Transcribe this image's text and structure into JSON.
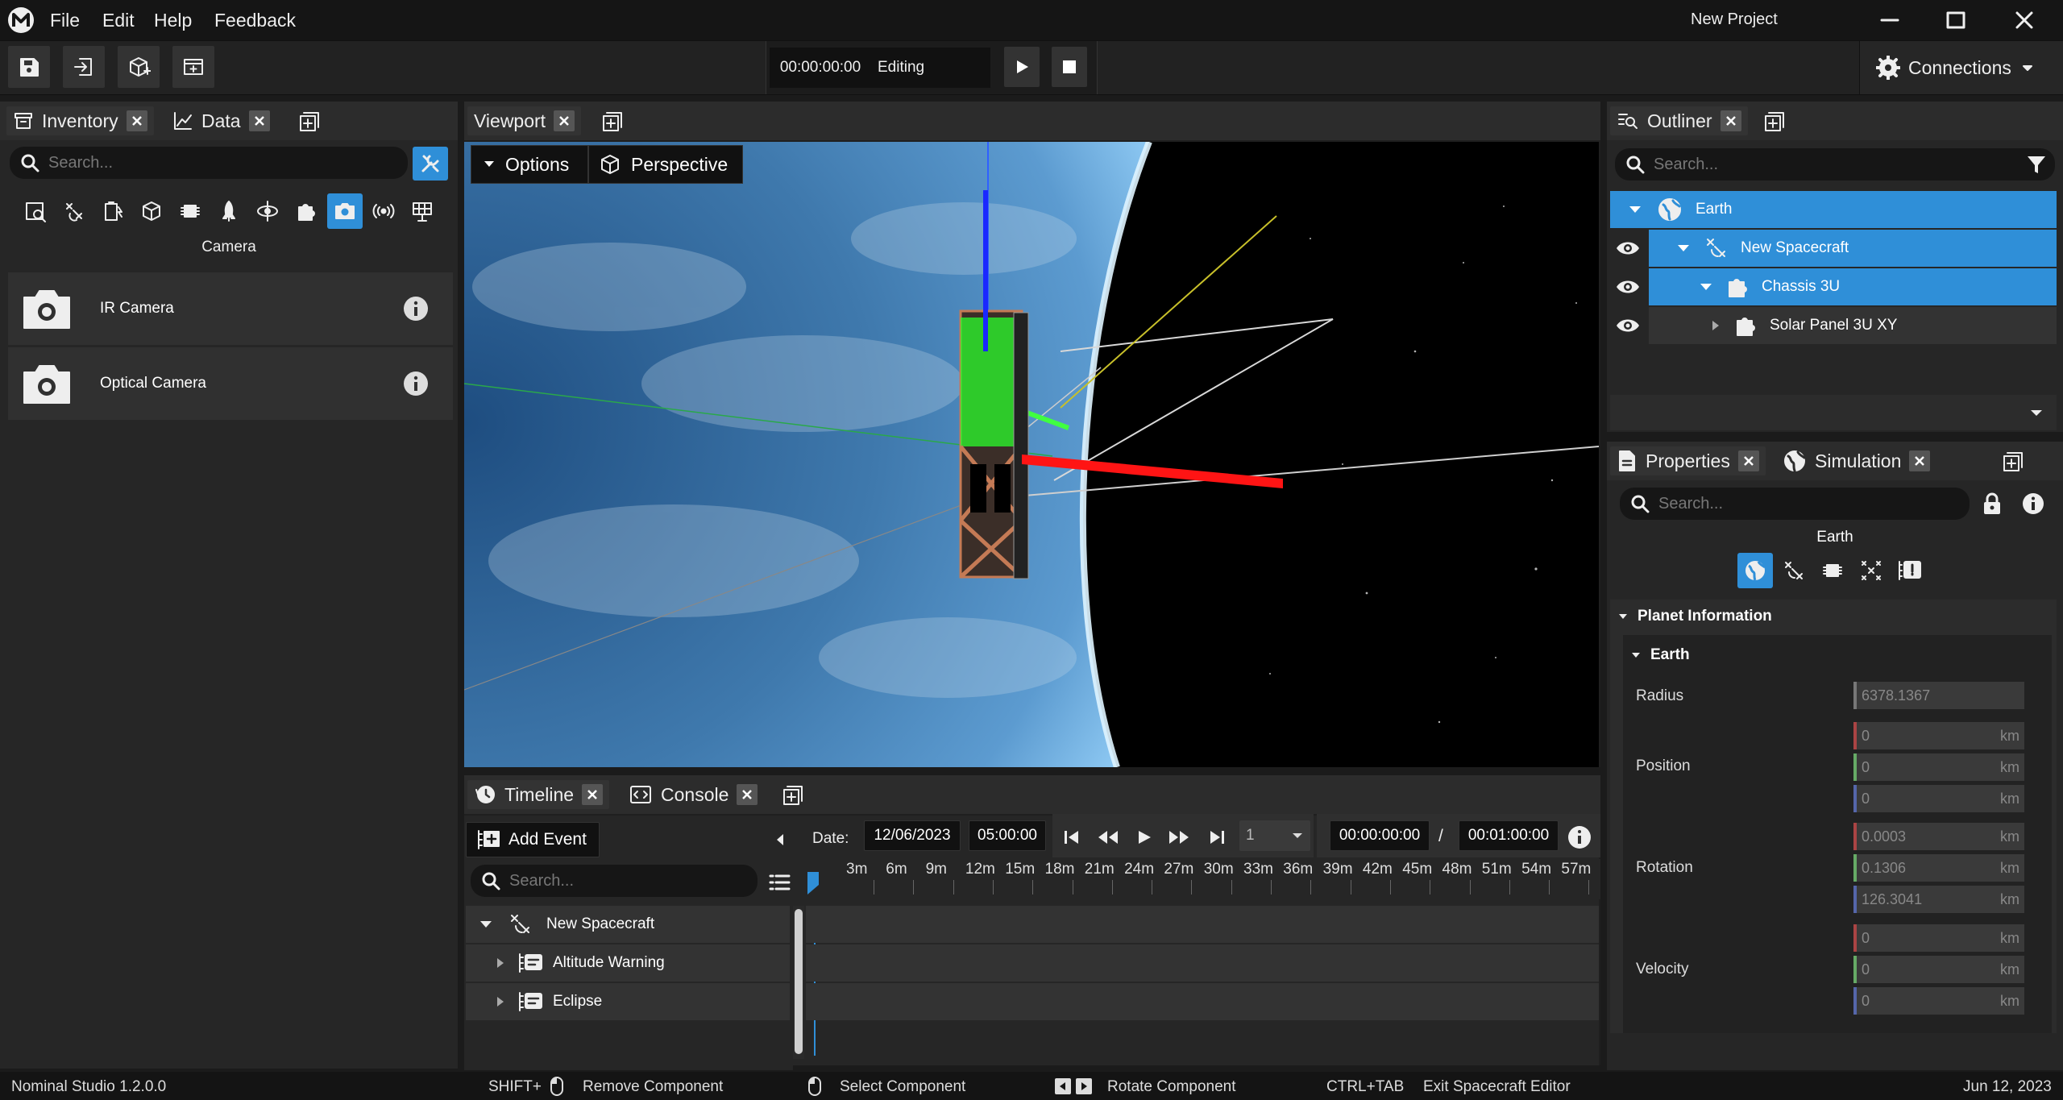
{
  "app": {
    "title": "New Project"
  },
  "menu": [
    "File",
    "Edit",
    "Help",
    "Feedback"
  ],
  "toolbar": {
    "time": "00:00:00:00",
    "mode": "Editing",
    "connections_label": "Connections"
  },
  "inventory": {
    "tabs": [
      {
        "label": "Inventory"
      },
      {
        "label": "Data"
      }
    ],
    "search_placeholder": "Search...",
    "category_label": "Camera",
    "categories": [
      "inventory-search",
      "satellite",
      "battery",
      "cube",
      "chip",
      "rocket",
      "orbit",
      "puzzle",
      "camera",
      "antenna",
      "solar-panel"
    ],
    "active_category": "camera",
    "items": [
      {
        "label": "IR Camera"
      },
      {
        "label": "Optical Camera"
      }
    ]
  },
  "viewport": {
    "tab_label": "Viewport",
    "options_label": "Options",
    "perspective_label": "Perspective"
  },
  "timeline": {
    "tabs": [
      {
        "label": "Timeline"
      },
      {
        "label": "Console"
      }
    ],
    "add_event_label": "Add Event",
    "search_placeholder": "Search...",
    "date_label": "Date:",
    "date": "12/06/2023",
    "time": "05:00:00",
    "speed": "1",
    "current_time": "00:00:00:00",
    "separator": "/",
    "end_time": "00:01:00:00",
    "ticks": [
      "3m",
      "6m",
      "9m",
      "12m",
      "15m",
      "18m",
      "21m",
      "24m",
      "27m",
      "30m",
      "33m",
      "36m",
      "39m",
      "42m",
      "45m",
      "48m",
      "51m",
      "54m",
      "57m"
    ],
    "rows": [
      {
        "label": "New Spacecraft"
      },
      {
        "label": "Altitude Warning"
      },
      {
        "label": "Eclipse"
      }
    ]
  },
  "outliner": {
    "tab_label": "Outliner",
    "search_placeholder": "Search...",
    "tree": [
      {
        "label": "Earth"
      },
      {
        "label": "New Spacecraft"
      },
      {
        "label": "Chassis 3U"
      },
      {
        "label": "Solar Panel 3U XY"
      }
    ]
  },
  "properties": {
    "tabs": [
      {
        "label": "Properties"
      },
      {
        "label": "Simulation"
      }
    ],
    "search_placeholder": "Search...",
    "object_name": "Earth",
    "section": "Planet Information",
    "subsection": "Earth",
    "radius": {
      "label": "Radius",
      "value": "6378.1367"
    },
    "position": {
      "label": "Position",
      "values": [
        "0",
        "0",
        "0"
      ],
      "unit": "km"
    },
    "rotation": {
      "label": "Rotation",
      "values": [
        "0.0003",
        "0.1306",
        "126.3041"
      ],
      "unit": "km"
    },
    "velocity": {
      "label": "Velocity",
      "values": [
        "0",
        "0",
        "0"
      ],
      "unit": "km"
    }
  },
  "statusbar": {
    "version": "Nominal Studio 1.2.0.0",
    "shift_key": "SHIFT+",
    "remove_label": "Remove Component",
    "select_label": "Select Component",
    "rotate_label": "Rotate Component",
    "ctrl_tab_key": "CTRL+TAB",
    "exit_label": "Exit Spacecraft Editor",
    "date": "Jun 12, 2023"
  },
  "colors": {
    "accent": "#2f8fd8",
    "selection": "#2f8fd8",
    "background": "#1b1b1b",
    "panel": "#262626"
  }
}
